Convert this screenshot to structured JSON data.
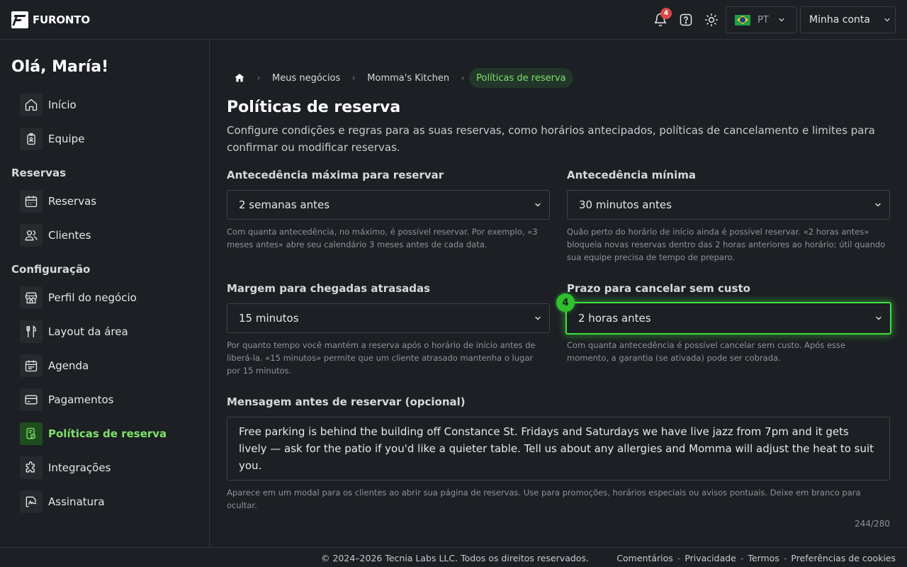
{
  "header": {
    "logo_text": "FURONTO",
    "notifications_count": "4",
    "language": "PT",
    "account_label": "Minha conta"
  },
  "sidebar": {
    "greeting": "Olá, María!",
    "items_top": [
      {
        "label": "Início",
        "icon": "home-icon"
      },
      {
        "label": "Equipe",
        "icon": "team-badge-icon"
      }
    ],
    "section_reservas": "Reservas",
    "items_reservas": [
      {
        "label": "Reservas",
        "icon": "calendar-icon"
      },
      {
        "label": "Clientes",
        "icon": "users-icon"
      }
    ],
    "section_config": "Configuração",
    "items_config": [
      {
        "label": "Perfil do negócio",
        "icon": "storefront-icon"
      },
      {
        "label": "Layout da área",
        "icon": "cutlery-icon"
      },
      {
        "label": "Agenda",
        "icon": "schedule-icon"
      },
      {
        "label": "Pagamentos",
        "icon": "credit-card-icon"
      },
      {
        "label": "Políticas de reserva",
        "icon": "policy-icon",
        "active": true
      },
      {
        "label": "Integrações",
        "icon": "puzzle-icon"
      },
      {
        "label": "Assinatura",
        "icon": "signature-icon"
      }
    ]
  },
  "breadcrumb": {
    "items": [
      "Meus negócios",
      "Momma's Kitchen",
      "Políticas de reserva"
    ]
  },
  "page": {
    "title": "Políticas de reserva",
    "description": "Configure condições e regras para as suas reservas, como horários antecipados, políticas de cancelamento e limites para confirmar ou modificar reservas."
  },
  "fields": {
    "max_advance": {
      "label": "Antecedência máxima para reservar",
      "value": "2 semanas antes",
      "help": "Com quanta antecedência, no máximo, é possível reservar. Por exemplo, «3 meses antes» abre seu calendário 3 meses antes de cada data."
    },
    "min_advance": {
      "label": "Antecedência mínima",
      "value": "30 minutos antes",
      "help": "Quão perto do horário de início ainda é possível reservar. «2 horas antes» bloqueia novas reservas dentro das 2 horas anteriores ao horário; útil quando sua equipe precisa de tempo de preparo."
    },
    "late_margin": {
      "label": "Margem para chegadas atrasadas",
      "value": "15 minutos",
      "help": "Por quanto tempo você mantém a reserva após o horário de início antes de liberá-la. «15 minutos» permite que um cliente atrasado mantenha o lugar por 15 minutos."
    },
    "free_cancel": {
      "label": "Prazo para cancelar sem custo",
      "value": "2 horas antes",
      "step": "4",
      "help": "Com quanta antecedência é possível cancelar sem custo. Após esse momento, a garantia (se ativada) pode ser cobrada."
    },
    "message": {
      "label": "Mensagem antes de reservar (opcional)",
      "value": "Free parking is behind the building off Constance St. Fridays and Saturdays we have live jazz from 7pm and it gets lively — ask for the patio if you'd like a quieter table. Tell us about any allergies and Momma will adjust the heat to suit you.",
      "help": "Aparece em um modal para os clientes ao abrir sua página de reservas. Use para promoções, horários especiais ou avisos pontuais. Deixe em branco para ocultar.",
      "counter": "244/280"
    }
  },
  "footer": {
    "copyright": "© 2024–2026 Tecnia Labs LLC. Todos os direitos reservados.",
    "links": [
      "Comentários",
      "Privacidade",
      "Termos",
      "Preferências de cookies"
    ],
    "separator": "-"
  },
  "colors": {
    "background": "#1c1f23",
    "accent": "#7ee26b",
    "focus": "#3fe03f",
    "badge": "#d94a4a"
  }
}
